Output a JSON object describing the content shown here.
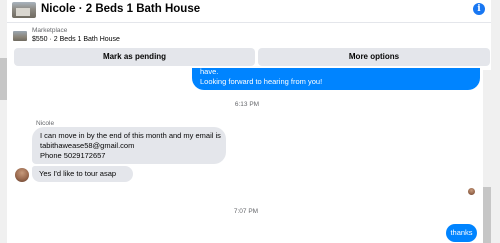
{
  "header": {
    "title": "Nicole · 2 Beds 1 Bath House",
    "info_icon": "info-icon"
  },
  "listing": {
    "label": "Marketplace",
    "title": "$550 · 2 Beds 1 Bath House"
  },
  "actions": {
    "mark_pending": "Mark as pending",
    "more_options": "More options"
  },
  "messages": {
    "outgoing_1": {
      "line1": "have.",
      "line2": "Looking forward to hearing from you!"
    },
    "timestamp_1": "6:13 PM",
    "sender_name": "Nicole",
    "incoming_1": {
      "line1": "I can move in by the end of this month and my email is",
      "line2": "tabithawease58@gmail.com",
      "line3": "Phone 5029172657"
    },
    "incoming_2": "Yes I'd like to tour asap",
    "timestamp_2": "7:07 PM",
    "outgoing_2": "thanks"
  },
  "colors": {
    "accent": "#0084ff",
    "info": "#1877f2",
    "button_bg": "#e4e6eb",
    "secondary_text": "#65676b"
  }
}
